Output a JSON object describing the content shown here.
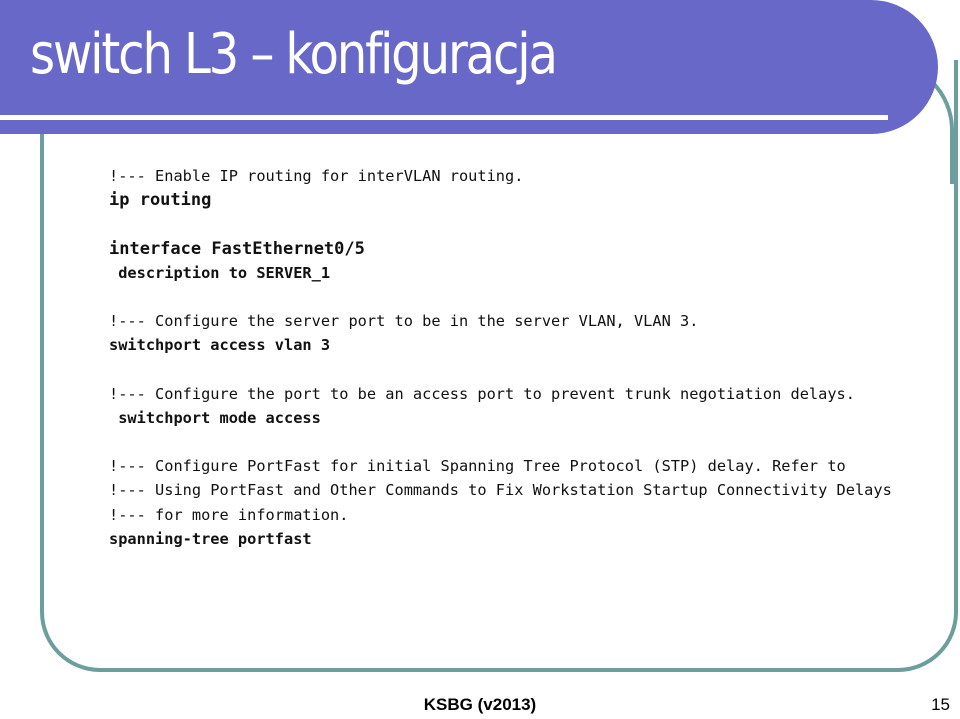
{
  "slide": {
    "title": "switch L3 – konfiguracja",
    "colors": {
      "header_bg": "#6868c9",
      "frame": "#6b9e9c",
      "title_text": "#ffffff",
      "body_text": "#111111"
    },
    "code_lines": [
      {
        "type": "comment",
        "text": "!--- Enable IP routing for interVLAN routing."
      },
      {
        "type": "cmd",
        "text": "ip routing"
      },
      {
        "type": "blank",
        "text": ""
      },
      {
        "type": "cmd",
        "text": "interface FastEthernet0/5"
      },
      {
        "type": "sub",
        "text": " description to SERVER_1"
      },
      {
        "type": "blank",
        "text": ""
      },
      {
        "type": "comment",
        "text": "!--- Configure the server port to be in the server VLAN, VLAN 3."
      },
      {
        "type": "sub",
        "text": "switchport access vlan 3"
      },
      {
        "type": "blank",
        "text": ""
      },
      {
        "type": "comment",
        "text": "!--- Configure the port to be an access port to prevent trunk negotiation delays."
      },
      {
        "type": "sub",
        "text": " switchport mode access"
      },
      {
        "type": "blank",
        "text": ""
      },
      {
        "type": "comment",
        "text": "!--- Configure PortFast for initial Spanning Tree Protocol (STP) delay. Refer to"
      },
      {
        "type": "comment",
        "text": "!--- Using PortFast and Other Commands to Fix Workstation Startup Connectivity Delays"
      },
      {
        "type": "comment",
        "text": "!--- for more information."
      },
      {
        "type": "sub",
        "text": "spanning-tree portfast"
      }
    ],
    "footer": {
      "label": "KSBG (v2013)",
      "page_number": "15"
    }
  }
}
